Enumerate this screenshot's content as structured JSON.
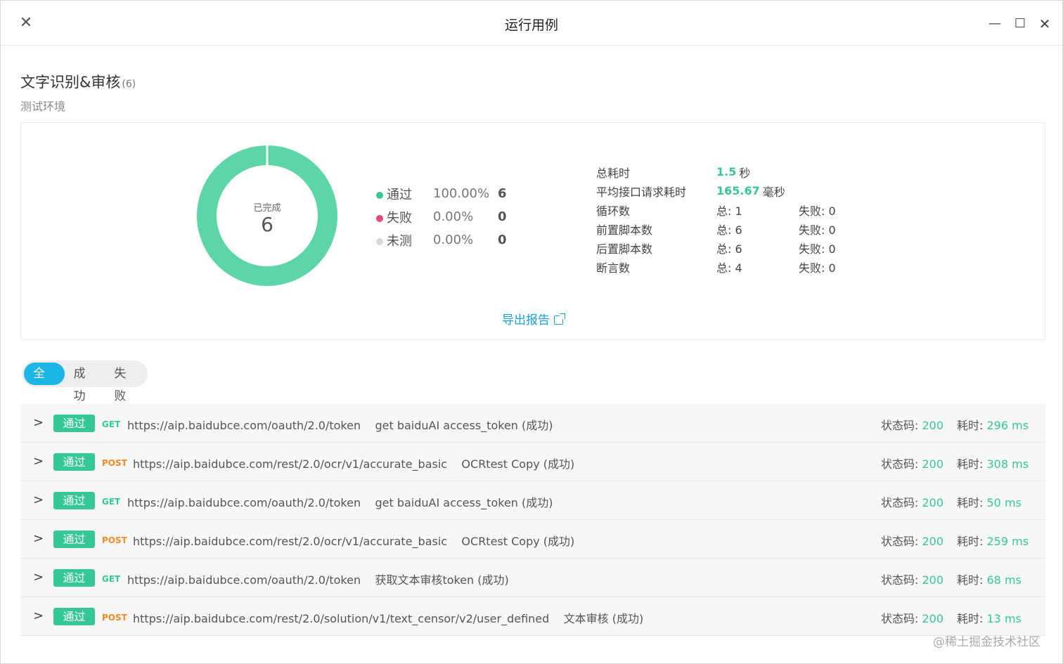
{
  "window": {
    "title": "运行用例",
    "close_glyph": "✕",
    "min_glyph": "—",
    "max_glyph": "☐",
    "close_right_glyph": "✕"
  },
  "header": {
    "title": "文字识别&审核",
    "count": "(6)",
    "environment": "测试环境"
  },
  "summary": {
    "donut_label": "已完成",
    "donut_value": "6",
    "legend": [
      {
        "name": "通过",
        "percent": "100.00%",
        "count": "6",
        "color": "#36c894"
      },
      {
        "name": "失败",
        "percent": "0.00%",
        "count": "0",
        "color": "#e8497a"
      },
      {
        "name": "未测",
        "percent": "0.00%",
        "count": "0",
        "color": "#d9d9d9"
      }
    ],
    "pass_fraction": 1.0,
    "stats": {
      "total_time_label": "总耗时",
      "total_time_value": "1.5",
      "total_time_unit": "秒",
      "avg_time_label": "平均接口请求耗时",
      "avg_time_value": "165.67",
      "avg_time_unit": "毫秒",
      "rows": [
        {
          "label": "循环数",
          "total": "总: 1",
          "failed": "失败: 0"
        },
        {
          "label": "前置脚本数",
          "total": "总: 6",
          "failed": "失败: 0"
        },
        {
          "label": "后置脚本数",
          "total": "总: 6",
          "failed": "失败: 0"
        },
        {
          "label": "断言数",
          "total": "总: 4",
          "failed": "失败: 0"
        }
      ]
    },
    "export_label": "导出报告"
  },
  "filter_tabs": [
    "全部",
    "成功",
    "失败"
  ],
  "results": [
    {
      "badge": "通过",
      "method": "GET",
      "url": "https://aip.baidubce.com/oauth/2.0/token",
      "name": "get baiduAI access_token (成功)",
      "status_label": "状态码:",
      "status": "200",
      "time_label": "耗时:",
      "time": "296 ms"
    },
    {
      "badge": "通过",
      "method": "POST",
      "url": "https://aip.baidubce.com/rest/2.0/ocr/v1/accurate_basic",
      "name": "OCRtest Copy (成功)",
      "status_label": "状态码:",
      "status": "200",
      "time_label": "耗时:",
      "time": "308 ms"
    },
    {
      "badge": "通过",
      "method": "GET",
      "url": "https://aip.baidubce.com/oauth/2.0/token",
      "name": "get baiduAI access_token (成功)",
      "status_label": "状态码:",
      "status": "200",
      "time_label": "耗时:",
      "time": "50 ms"
    },
    {
      "badge": "通过",
      "method": "POST",
      "url": "https://aip.baidubce.com/rest/2.0/ocr/v1/accurate_basic",
      "name": "OCRtest Copy (成功)",
      "status_label": "状态码:",
      "status": "200",
      "time_label": "耗时:",
      "time": "259 ms"
    },
    {
      "badge": "通过",
      "method": "GET",
      "url": "https://aip.baidubce.com/oauth/2.0/token",
      "name": "获取文本审核token (成功)",
      "status_label": "状态码:",
      "status": "200",
      "time_label": "耗时:",
      "time": "68 ms"
    },
    {
      "badge": "通过",
      "method": "POST",
      "url": "https://aip.baidubce.com/rest/2.0/solution/v1/text_censor/v2/user_defined",
      "name": "文本审核 (成功)",
      "status_label": "状态码:",
      "status": "200",
      "time_label": "耗时:",
      "time": "13 ms"
    }
  ],
  "watermark": "@稀土掘金技术社区"
}
